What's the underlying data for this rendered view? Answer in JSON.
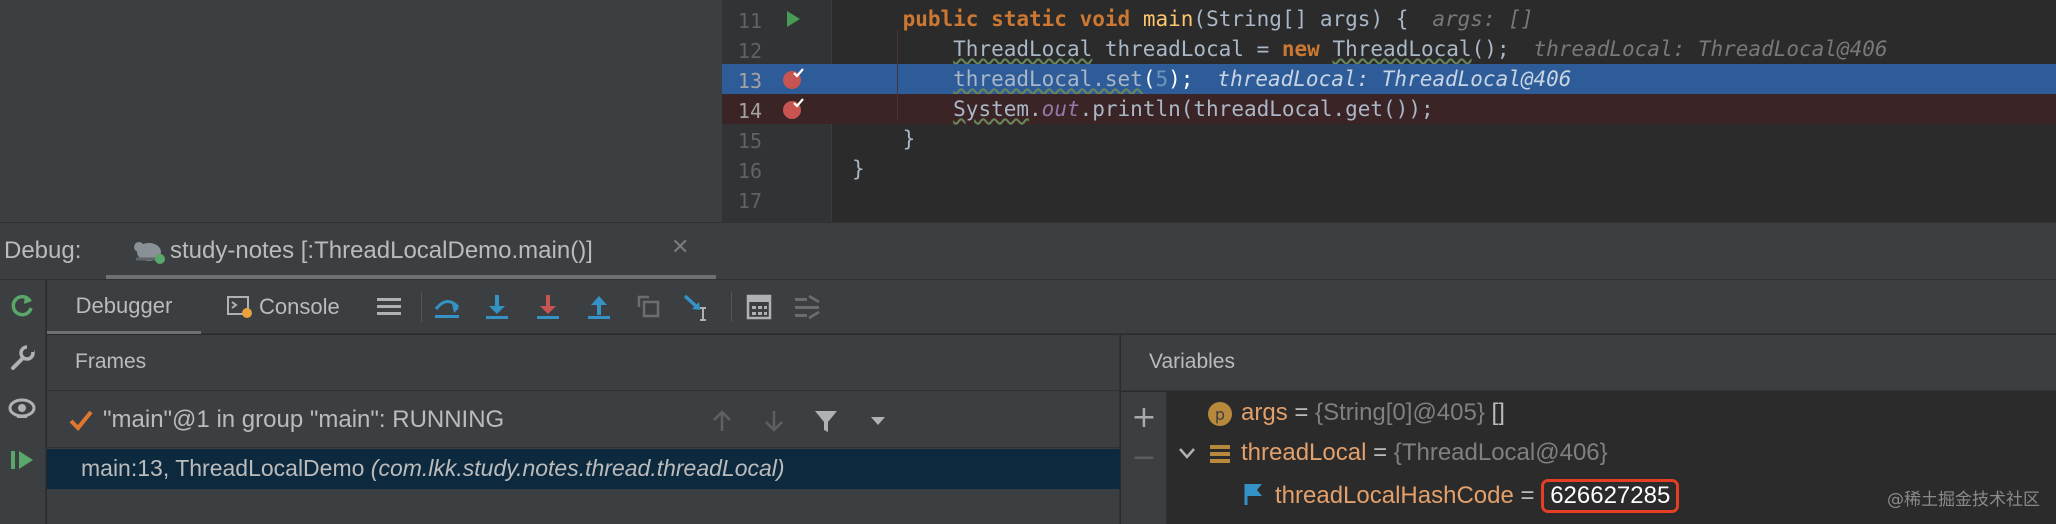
{
  "editor": {
    "lines": [
      {
        "no": "11",
        "marker": "run",
        "tokens": [
          {
            "t": "    "
          },
          {
            "t": "public",
            "c": "kw-bold"
          },
          {
            "t": " "
          },
          {
            "t": "static",
            "c": "kw-bold"
          },
          {
            "t": " "
          },
          {
            "t": "void",
            "c": "kw-bold"
          },
          {
            "t": " "
          },
          {
            "t": "main",
            "c": "fn"
          },
          {
            "t": "("
          },
          {
            "t": "String",
            "c": "ty"
          },
          {
            "t": "[] args) {"
          }
        ],
        "hint": "args: []"
      },
      {
        "no": "12",
        "marker": "",
        "tokens": [
          {
            "t": "        "
          },
          {
            "t": "ThreadLocal",
            "c": "ty-u"
          },
          {
            "t": " threadLocal = "
          },
          {
            "t": "new",
            "c": "kw-bold"
          },
          {
            "t": " "
          },
          {
            "t": "ThreadLocal",
            "c": "ty-u"
          },
          {
            "t": "();"
          }
        ],
        "hint": "threadLocal: ThreadLocal@406"
      },
      {
        "no": "13",
        "marker": "breakpoint-checked",
        "highlight": "blue",
        "tokens": [
          {
            "t": "        "
          },
          {
            "t": "threadLocal.set",
            "c": "ty-u"
          },
          {
            "t": "("
          },
          {
            "t": "5",
            "c": "num"
          },
          {
            "t": ");"
          }
        ],
        "hint": "threadLocal: ThreadLocal@406"
      },
      {
        "no": "14",
        "marker": "breakpoint-checked",
        "highlight": "red",
        "tokens": [
          {
            "t": "        "
          },
          {
            "t": "System",
            "c": "ty-u"
          },
          {
            "t": "."
          },
          {
            "t": "out",
            "c": "st"
          },
          {
            "t": ".println(threadLocal.get());"
          }
        ],
        "hint": ""
      },
      {
        "no": "15",
        "marker": "",
        "tokens": [
          {
            "t": "    }"
          }
        ],
        "hint": ""
      },
      {
        "no": "16",
        "marker": "",
        "tokens": [
          {
            "t": "}"
          }
        ],
        "hint": ""
      },
      {
        "no": "17",
        "marker": "",
        "tokens": [],
        "hint": ""
      }
    ]
  },
  "debug": {
    "title": "Debug:",
    "session_label": "study-notes [:ThreadLocalDemo.main()]",
    "close_glyph": "✕"
  },
  "toolbar": {
    "debugger_label": "Debugger",
    "console_label": "Console"
  },
  "frames": {
    "title": "Frames",
    "thread_label": "\"main\"@1 in group \"main\": RUNNING",
    "frame_method": "main:13, ThreadLocalDemo ",
    "frame_package": "(com.lkk.study.notes.thread.threadLocal)"
  },
  "variables": {
    "title": "Variables",
    "rows": [
      {
        "name": "args",
        "eq": " = ",
        "type": "{String[0]@405}",
        "value": " []",
        "icon": "p"
      },
      {
        "name": "threadLocal",
        "eq": " = ",
        "type": "{ThreadLocal@406}",
        "value": "",
        "icon": "object"
      },
      {
        "name": "threadLocalHashCode",
        "eq": " = ",
        "type": "",
        "value": "626627285",
        "icon": "field"
      }
    ],
    "add_glyph": "+",
    "remove_glyph": "−"
  },
  "watermark": "@稀土掘金技术社区",
  "colors": {
    "run_green": "#499c54",
    "breakpoint_red": "#c75450",
    "line_blue": "#2e5c99",
    "highlight_box": "#e53e25"
  }
}
